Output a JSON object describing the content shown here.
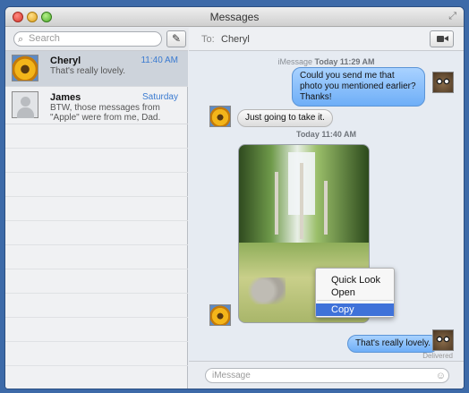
{
  "window": {
    "title": "Messages"
  },
  "sidebar": {
    "search_placeholder": "Search",
    "conversations": [
      {
        "name": "Cheryl",
        "time": "11:40 AM",
        "preview": "That's really lovely.",
        "avatar": "sunflower-icon"
      },
      {
        "name": "James",
        "time": "Saturday",
        "preview": "BTW, those messages from \"Apple\" were from me, Dad.",
        "avatar": "person-icon"
      }
    ]
  },
  "header": {
    "to_label": "To:",
    "recipient": "Cheryl"
  },
  "transcript": {
    "timestamp1_service": "iMessage",
    "timestamp1_time": "Today 11:29 AM",
    "msg1": "Could you send me that photo you mentioned earlier? Thanks!",
    "msg2": "Just going to take it.",
    "timestamp2": "Today 11:40 AM",
    "msg4": "That's really lovely.",
    "delivered": "Delivered"
  },
  "context_menu": {
    "items": [
      "Quick Look",
      "Open",
      "Copy"
    ],
    "highlighted": "Copy"
  },
  "composer": {
    "placeholder": "iMessage"
  },
  "colors": {
    "accent": "#3f72d9",
    "bubble_blue": "#6eaef7",
    "selection": "#cdd3db"
  }
}
